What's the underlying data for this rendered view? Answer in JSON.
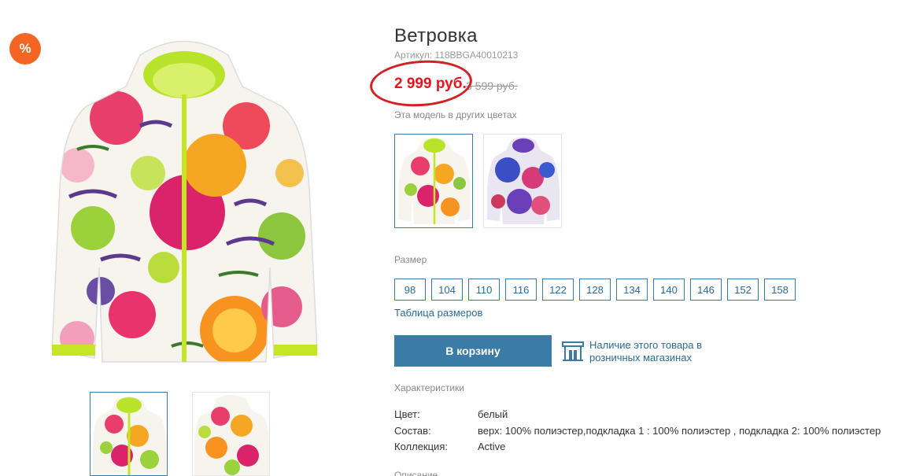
{
  "badge": {
    "label": "%"
  },
  "product": {
    "title": "Ветровка",
    "sku": "Артикул: 118BBGA40010213",
    "price": "2 999 руб.",
    "old_price": "3 599 руб."
  },
  "colors": {
    "label": "Эта модель в других цветах"
  },
  "sizes": {
    "label": "Размер",
    "options": [
      "98",
      "104",
      "110",
      "116",
      "122",
      "128",
      "134",
      "140",
      "146",
      "152",
      "158"
    ],
    "table_link": "Таблица размеров"
  },
  "actions": {
    "cart_label": "В корзину",
    "store_availability": "Наличие этого товара в розничных магазинах"
  },
  "characteristics": {
    "label": "Характеристики",
    "rows": [
      {
        "key": "Цвет:",
        "value": "белый"
      },
      {
        "key": "Состав:",
        "value": "верх: 100% полиэстер,подкладка 1 : 100% полиэстер , подкладка 2: 100% полиэстер"
      },
      {
        "key": "Коллекция:",
        "value": "Active"
      }
    ]
  },
  "description": {
    "label": "Описание"
  },
  "theme": {
    "accent": "#3a7ca5",
    "price_red": "#e8131e",
    "badge_orange": "#f26522"
  }
}
